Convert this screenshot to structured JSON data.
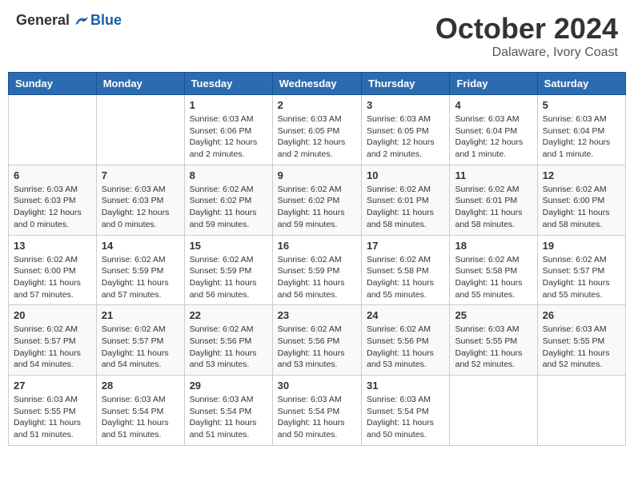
{
  "header": {
    "logo_general": "General",
    "logo_blue": "Blue",
    "month_title": "October 2024",
    "location": "Dalaware, Ivory Coast"
  },
  "days_of_week": [
    "Sunday",
    "Monday",
    "Tuesday",
    "Wednesday",
    "Thursday",
    "Friday",
    "Saturday"
  ],
  "weeks": [
    [
      {
        "day": "",
        "info": ""
      },
      {
        "day": "",
        "info": ""
      },
      {
        "day": "1",
        "info": "Sunrise: 6:03 AM\nSunset: 6:06 PM\nDaylight: 12 hours and 2 minutes."
      },
      {
        "day": "2",
        "info": "Sunrise: 6:03 AM\nSunset: 6:05 PM\nDaylight: 12 hours and 2 minutes."
      },
      {
        "day": "3",
        "info": "Sunrise: 6:03 AM\nSunset: 6:05 PM\nDaylight: 12 hours and 2 minutes."
      },
      {
        "day": "4",
        "info": "Sunrise: 6:03 AM\nSunset: 6:04 PM\nDaylight: 12 hours and 1 minute."
      },
      {
        "day": "5",
        "info": "Sunrise: 6:03 AM\nSunset: 6:04 PM\nDaylight: 12 hours and 1 minute."
      }
    ],
    [
      {
        "day": "6",
        "info": "Sunrise: 6:03 AM\nSunset: 6:03 PM\nDaylight: 12 hours and 0 minutes."
      },
      {
        "day": "7",
        "info": "Sunrise: 6:03 AM\nSunset: 6:03 PM\nDaylight: 12 hours and 0 minutes."
      },
      {
        "day": "8",
        "info": "Sunrise: 6:02 AM\nSunset: 6:02 PM\nDaylight: 11 hours and 59 minutes."
      },
      {
        "day": "9",
        "info": "Sunrise: 6:02 AM\nSunset: 6:02 PM\nDaylight: 11 hours and 59 minutes."
      },
      {
        "day": "10",
        "info": "Sunrise: 6:02 AM\nSunset: 6:01 PM\nDaylight: 11 hours and 58 minutes."
      },
      {
        "day": "11",
        "info": "Sunrise: 6:02 AM\nSunset: 6:01 PM\nDaylight: 11 hours and 58 minutes."
      },
      {
        "day": "12",
        "info": "Sunrise: 6:02 AM\nSunset: 6:00 PM\nDaylight: 11 hours and 58 minutes."
      }
    ],
    [
      {
        "day": "13",
        "info": "Sunrise: 6:02 AM\nSunset: 6:00 PM\nDaylight: 11 hours and 57 minutes."
      },
      {
        "day": "14",
        "info": "Sunrise: 6:02 AM\nSunset: 5:59 PM\nDaylight: 11 hours and 57 minutes."
      },
      {
        "day": "15",
        "info": "Sunrise: 6:02 AM\nSunset: 5:59 PM\nDaylight: 11 hours and 56 minutes."
      },
      {
        "day": "16",
        "info": "Sunrise: 6:02 AM\nSunset: 5:59 PM\nDaylight: 11 hours and 56 minutes."
      },
      {
        "day": "17",
        "info": "Sunrise: 6:02 AM\nSunset: 5:58 PM\nDaylight: 11 hours and 55 minutes."
      },
      {
        "day": "18",
        "info": "Sunrise: 6:02 AM\nSunset: 5:58 PM\nDaylight: 11 hours and 55 minutes."
      },
      {
        "day": "19",
        "info": "Sunrise: 6:02 AM\nSunset: 5:57 PM\nDaylight: 11 hours and 55 minutes."
      }
    ],
    [
      {
        "day": "20",
        "info": "Sunrise: 6:02 AM\nSunset: 5:57 PM\nDaylight: 11 hours and 54 minutes."
      },
      {
        "day": "21",
        "info": "Sunrise: 6:02 AM\nSunset: 5:57 PM\nDaylight: 11 hours and 54 minutes."
      },
      {
        "day": "22",
        "info": "Sunrise: 6:02 AM\nSunset: 5:56 PM\nDaylight: 11 hours and 53 minutes."
      },
      {
        "day": "23",
        "info": "Sunrise: 6:02 AM\nSunset: 5:56 PM\nDaylight: 11 hours and 53 minutes."
      },
      {
        "day": "24",
        "info": "Sunrise: 6:02 AM\nSunset: 5:56 PM\nDaylight: 11 hours and 53 minutes."
      },
      {
        "day": "25",
        "info": "Sunrise: 6:03 AM\nSunset: 5:55 PM\nDaylight: 11 hours and 52 minutes."
      },
      {
        "day": "26",
        "info": "Sunrise: 6:03 AM\nSunset: 5:55 PM\nDaylight: 11 hours and 52 minutes."
      }
    ],
    [
      {
        "day": "27",
        "info": "Sunrise: 6:03 AM\nSunset: 5:55 PM\nDaylight: 11 hours and 51 minutes."
      },
      {
        "day": "28",
        "info": "Sunrise: 6:03 AM\nSunset: 5:54 PM\nDaylight: 11 hours and 51 minutes."
      },
      {
        "day": "29",
        "info": "Sunrise: 6:03 AM\nSunset: 5:54 PM\nDaylight: 11 hours and 51 minutes."
      },
      {
        "day": "30",
        "info": "Sunrise: 6:03 AM\nSunset: 5:54 PM\nDaylight: 11 hours and 50 minutes."
      },
      {
        "day": "31",
        "info": "Sunrise: 6:03 AM\nSunset: 5:54 PM\nDaylight: 11 hours and 50 minutes."
      },
      {
        "day": "",
        "info": ""
      },
      {
        "day": "",
        "info": ""
      }
    ]
  ]
}
